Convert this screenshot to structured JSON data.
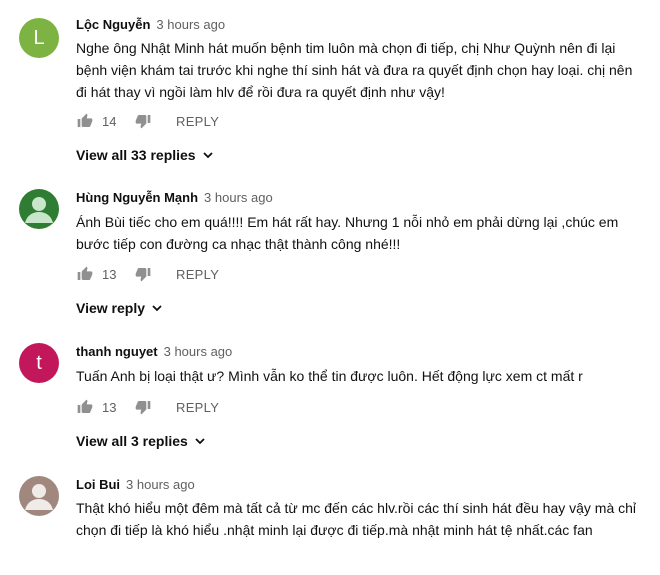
{
  "comments": [
    {
      "author": "Lộc Nguyễn",
      "time": "3 hours ago",
      "avatar_letter": "L",
      "avatar_color": "#7cb342",
      "text": "Nghe ông Nhật Minh hát muốn bệnh tim luôn mà chọn đi tiếp, chị Như Quỳnh nên đi lại bệnh viện khám tai trước khi nghe thí sinh hát và đưa ra quyết định chọn hay loại. chị nên đi hát thay vì ngồi làm hlv để rồi đưa ra quyết định như vậy!",
      "likes": "14",
      "reply_label": "REPLY",
      "view_replies": "View all 33 replies"
    },
    {
      "author": "Hùng Nguyễn Mạnh",
      "time": "3 hours ago",
      "avatar_icon": "user-silhouette-icon",
      "avatar_color": "#2e7d32",
      "text": "Ánh Bùi tiếc cho em quá!!!! Em hát rất hay. Nhưng 1 nỗi nhỏ em phải dừng lại ,chúc em bước tiếp con đường ca nhạc thật thành công nhé!!!",
      "likes": "13",
      "reply_label": "REPLY",
      "view_replies": "View reply"
    },
    {
      "author": "thanh nguyet",
      "time": "3 hours ago",
      "avatar_letter": "t",
      "avatar_color": "#c2185b",
      "text": "Tuấn Anh bị loại thật ư? Mình vẫn ko thể tin được luôn. Hết động lực xem ct mất r",
      "likes": "13",
      "reply_label": "REPLY",
      "view_replies": "View all 3 replies"
    },
    {
      "author": "Loi Bui",
      "time": "3 hours ago",
      "avatar_icon": "user-silhouette-icon",
      "avatar_color": "#a1887f",
      "text": "Thật khó hiểu một đêm mà tất cả từ mc đến các hlv.rồi các thí sinh hát đều hay vậy mà chỉ chọn đi tiếp là khó hiểu .nhật minh lại được đi tiếp.mà nhật minh hát tệ nhất.các fan"
    }
  ]
}
